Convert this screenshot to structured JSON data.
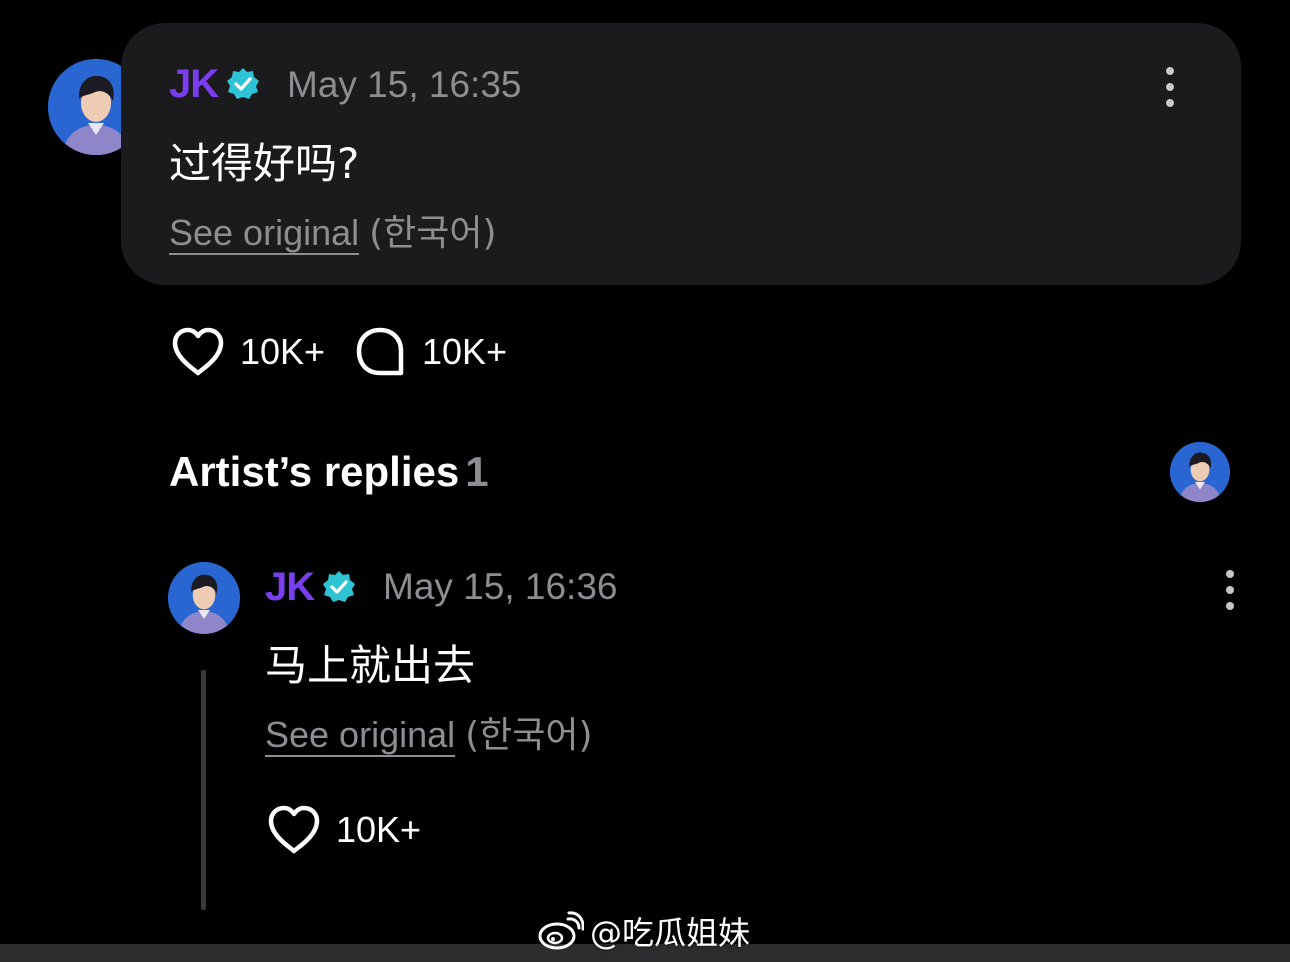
{
  "post": {
    "author": "JK",
    "timestamp": "May 15, 16:35",
    "text": "过得好吗?",
    "see_original": "See original",
    "original_language": "(한국어)",
    "likes": "10K+",
    "comments": "10K+"
  },
  "replies_section": {
    "title": "Artist’s replies",
    "count": "1"
  },
  "reply": {
    "author": "JK",
    "timestamp": "May 15, 16:36",
    "text": "马上就出去",
    "see_original": "See original",
    "original_language": "(한국어)",
    "likes": "10K+"
  },
  "watermark": {
    "text": "@吃瓜姐妹"
  },
  "colors": {
    "background": "#000000",
    "card": "#1b1b1d",
    "author_name": "#7a3df0",
    "verified_badge": "#2ec4d6",
    "muted_text": "#8d8d92"
  },
  "icons": [
    "verified-badge-icon",
    "more-options-icon",
    "heart-icon",
    "comment-icon",
    "weibo-logo-icon"
  ]
}
